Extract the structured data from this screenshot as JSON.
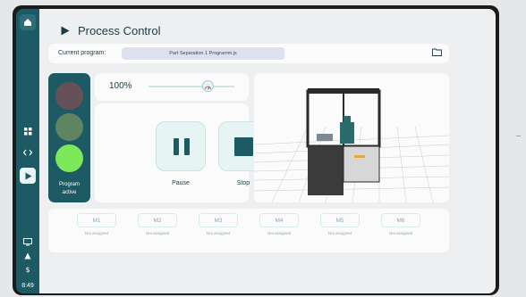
{
  "colors": {
    "teal_dark": "#1e5a63",
    "background": "#eeeff0",
    "green_light": "#7ce85a"
  },
  "sidebar": {
    "time": "8:49",
    "icons": [
      "home-icon",
      "grid-icon",
      "code-icon",
      "play-icon",
      "monitor-icon",
      "user-icon",
      "dollar-icon"
    ]
  },
  "page": {
    "title": "Process Control"
  },
  "program": {
    "label": "Current program:",
    "value": "Part Separation 1 Programm.js"
  },
  "traffic_light": {
    "label_line1": "Program",
    "label_line2": "active",
    "state": "green"
  },
  "speed": {
    "value": "100%",
    "level": 1.0
  },
  "controls": {
    "pause_label": "Pause",
    "stop_label": "Stop"
  },
  "motors": [
    {
      "name": "M1",
      "status": "Not assigned"
    },
    {
      "name": "M2",
      "status": "Not assigned"
    },
    {
      "name": "M3",
      "status": "Not assigned"
    },
    {
      "name": "M4",
      "status": "Not assigned"
    },
    {
      "name": "M5",
      "status": "Not assigned"
    },
    {
      "name": "M6",
      "status": "Not assigned"
    }
  ]
}
